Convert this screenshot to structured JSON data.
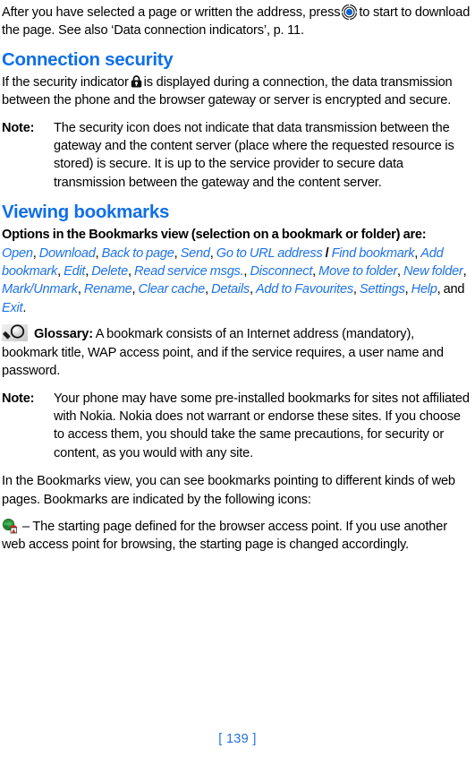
{
  "document": {
    "page_number_label": "[ 139 ]",
    "accent_color": "#0f6fe8",
    "link_color": "#1e73e8",
    "text_color": "#000000",
    "background_color": "#ffffff"
  },
  "intro_paragraph": {
    "part1": "After you have selected a page or written the address, press",
    "icon": "navigation-key-icon",
    "part2": "to start to download the page. See also ‘Data connection indicators’, p. 11."
  },
  "connection_security": {
    "heading": "Connection security",
    "paragraph_part1": "If the security indicator",
    "icon": "padlock-icon",
    "paragraph_part2": "is displayed during a connection, the data transmission between the phone and the browser gateway or server is encrypted and secure.",
    "note": {
      "label": "Note:",
      "text": "The security icon does not indicate that data transmission between the gateway and the content server (place where the requested resource is stored) is secure. It is up to the service provider to secure data transmission between the gateway and the content server."
    }
  },
  "viewing_bookmarks": {
    "heading": "Viewing bookmarks",
    "options_intro": "Options in the Bookmarks view (selection on a bookmark or folder) are:",
    "options": [
      "Open",
      "Download",
      "Back to page",
      "Send",
      "Go to URL address",
      "Find bookmark",
      "Add bookmark",
      "Edit",
      "Delete",
      "Read service msgs.",
      "Disconnect",
      "Move to folder",
      "New folder",
      "Mark/Unmark",
      "Rename",
      "Clear cache",
      "Details",
      "Add to Favourites",
      "Settings",
      "Help",
      "Exit"
    ],
    "options_separator": ", ",
    "options_slash": "/",
    "options_and": "and",
    "options_terminator": ".",
    "options_slash_after_index": 4,
    "glossary": {
      "icon": "magnifier-icon",
      "label": "Glossary:",
      "text": "A bookmark consists of an Internet address (mandatory), bookmark title, WAP access point, and if the service requires, a user name and password."
    },
    "note": {
      "label": "Note:",
      "text": "Your phone may have some pre-installed bookmarks for sites not affiliated with Nokia. Nokia does not warrant or endorse these sites. If you choose to access them, you should take the same precautions, for security or content, as you would with any site."
    },
    "bookmarks_intro": "In the Bookmarks view, you can see bookmarks pointing to different kinds of web pages. Bookmarks are indicated by the following icons:",
    "bookmark_items": [
      {
        "icon": "globe-home-icon",
        "text": "– The starting page defined for the browser access point. If you use another web access point for browsing, the starting page is changed accordingly."
      }
    ]
  }
}
